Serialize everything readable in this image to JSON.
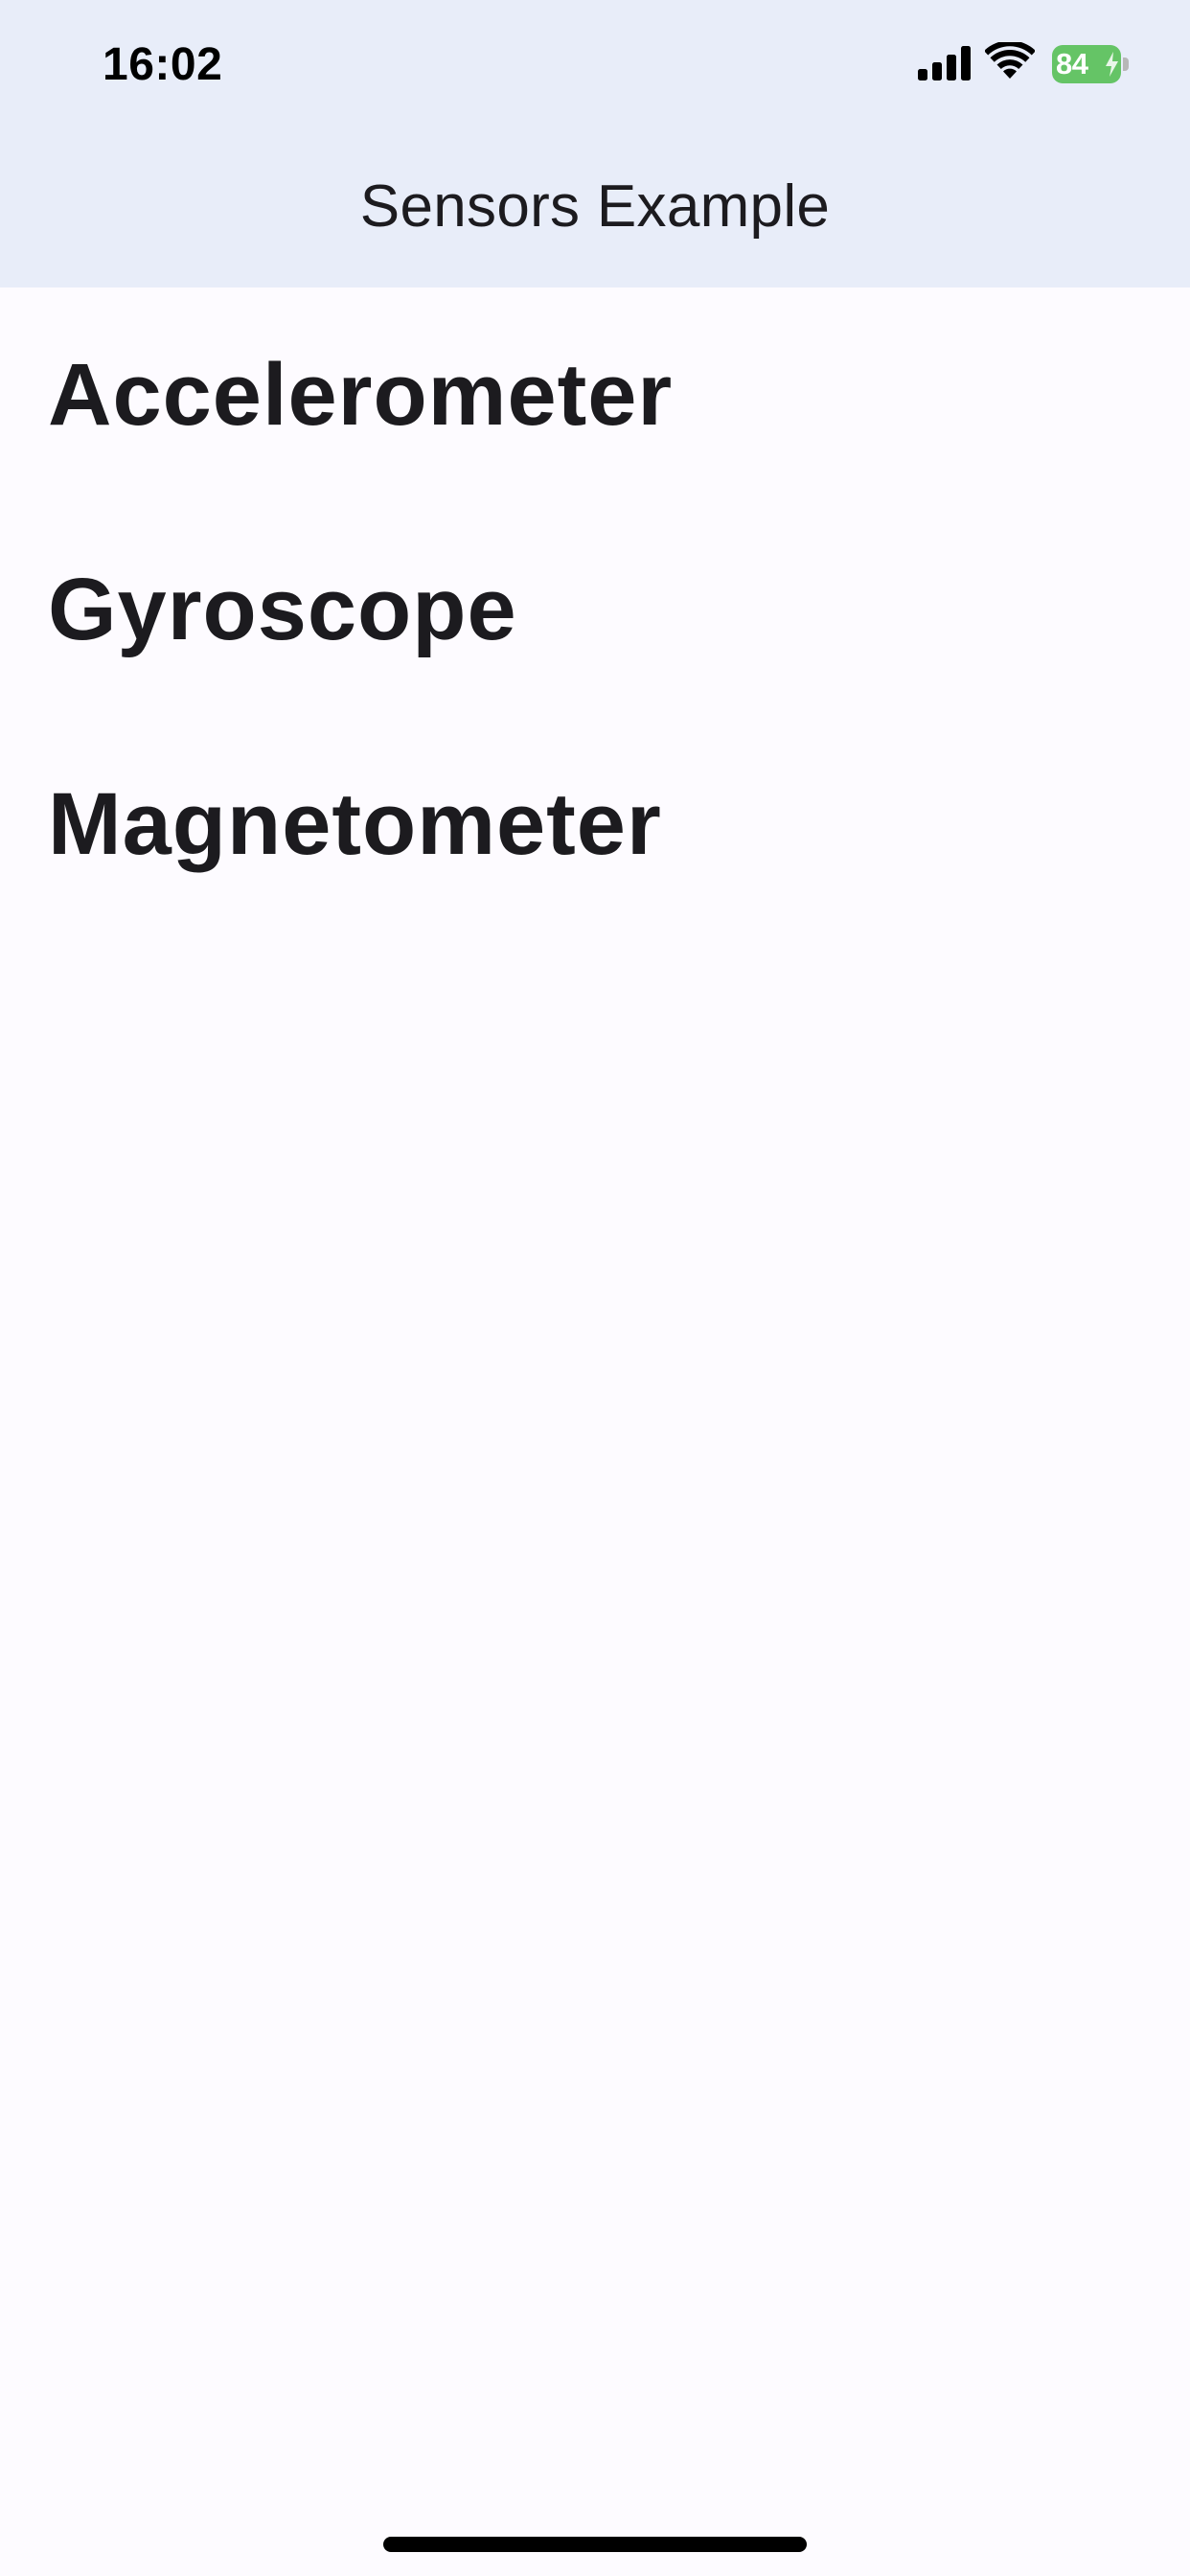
{
  "status_bar": {
    "time": "16:02",
    "battery_level": "84",
    "battery_color": "#65c466",
    "icons": [
      "cellular-signal-icon",
      "wifi-icon",
      "battery-icon",
      "charging-bolt-icon"
    ]
  },
  "app_bar": {
    "title": "Sensors Example",
    "background": "#e8edf9"
  },
  "sensors": {
    "items": [
      {
        "label": "Accelerometer"
      },
      {
        "label": "Gyroscope"
      },
      {
        "label": "Magnetometer"
      }
    ]
  },
  "colors": {
    "page_background": "#fdfbff",
    "text": "#1c1b1f"
  }
}
